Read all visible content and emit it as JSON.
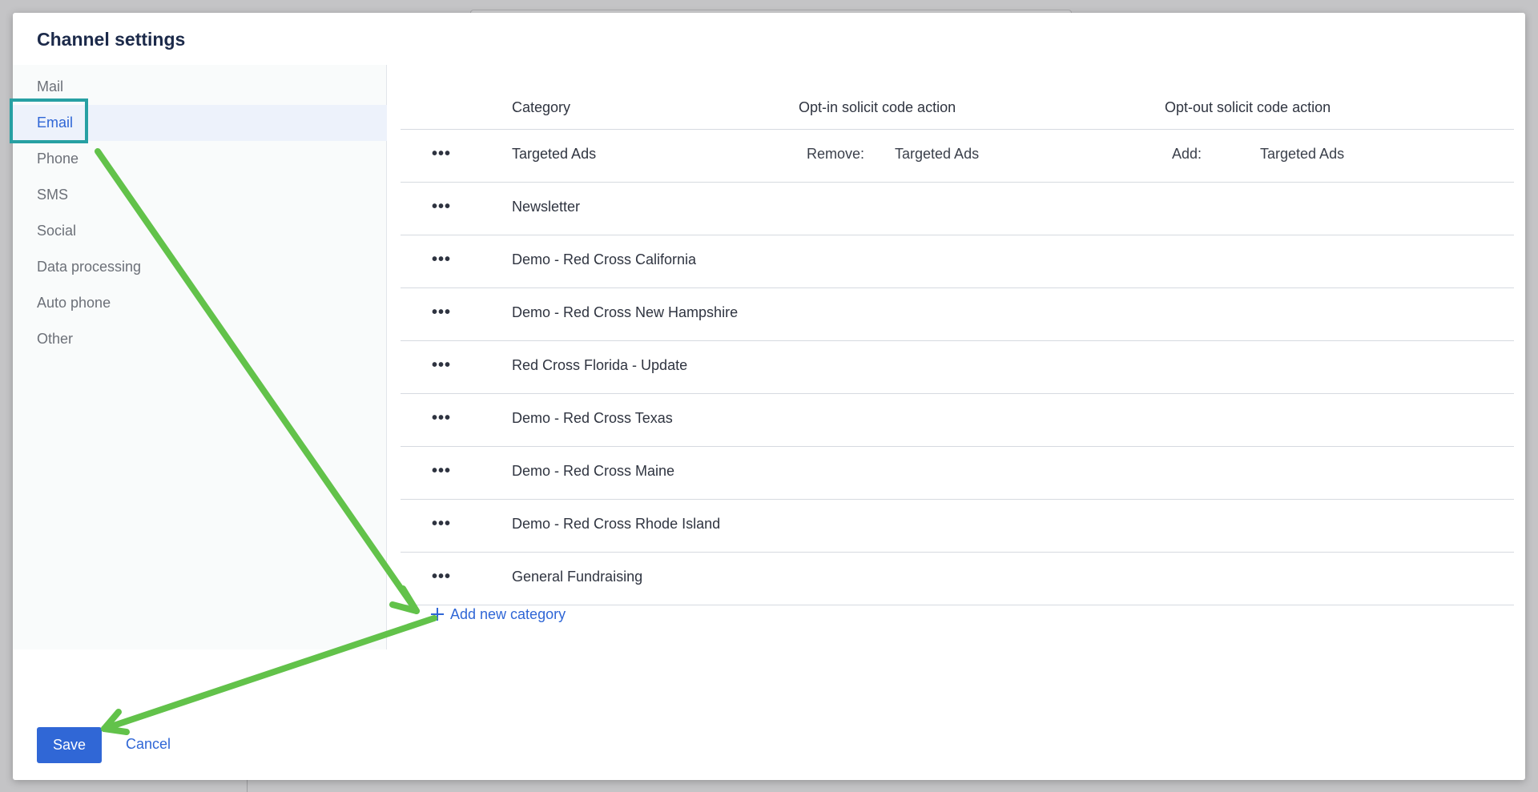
{
  "modal": {
    "title": "Channel settings",
    "save_label": "Save",
    "cancel_label": "Cancel"
  },
  "sidebar": {
    "items": [
      {
        "label": "Mail"
      },
      {
        "label": "Email"
      },
      {
        "label": "Phone"
      },
      {
        "label": "SMS"
      },
      {
        "label": "Social"
      },
      {
        "label": "Data processing"
      },
      {
        "label": "Auto phone"
      },
      {
        "label": "Other"
      }
    ],
    "active_index": 1
  },
  "table": {
    "headers": {
      "category": "Category",
      "optin": "Opt-in solicit code action",
      "optout": "Opt-out solicit code action"
    },
    "row_menu_glyph": "•••",
    "rows": [
      {
        "category": "Targeted Ads",
        "optin_label": "Remove:",
        "optin_value": "Targeted Ads",
        "optout_label": "Add:",
        "optout_value": "Targeted Ads"
      },
      {
        "category": "Newsletter",
        "optin_label": "",
        "optin_value": "",
        "optout_label": "",
        "optout_value": ""
      },
      {
        "category": "Demo - Red Cross California",
        "optin_label": "",
        "optin_value": "",
        "optout_label": "",
        "optout_value": ""
      },
      {
        "category": "Demo - Red Cross New Hampshire",
        "optin_label": "",
        "optin_value": "",
        "optout_label": "",
        "optout_value": ""
      },
      {
        "category": "Red Cross Florida - Update",
        "optin_label": "",
        "optin_value": "",
        "optout_label": "",
        "optout_value": ""
      },
      {
        "category": "Demo - Red Cross Texas",
        "optin_label": "",
        "optin_value": "",
        "optout_label": "",
        "optout_value": ""
      },
      {
        "category": "Demo - Red Cross Maine",
        "optin_label": "",
        "optin_value": "",
        "optout_label": "",
        "optout_value": ""
      },
      {
        "category": "Demo - Red Cross Rhode Island",
        "optin_label": "",
        "optin_value": "",
        "optout_label": "",
        "optout_value": ""
      },
      {
        "category": "General Fundraising",
        "optin_label": "",
        "optin_value": "",
        "optout_label": "",
        "optout_value": ""
      }
    ],
    "add_label": "Add new category"
  },
  "colors": {
    "accent": "#3067d6",
    "annotation_arrow": "#62c24a",
    "focus_highlight": "#27a0a3"
  }
}
